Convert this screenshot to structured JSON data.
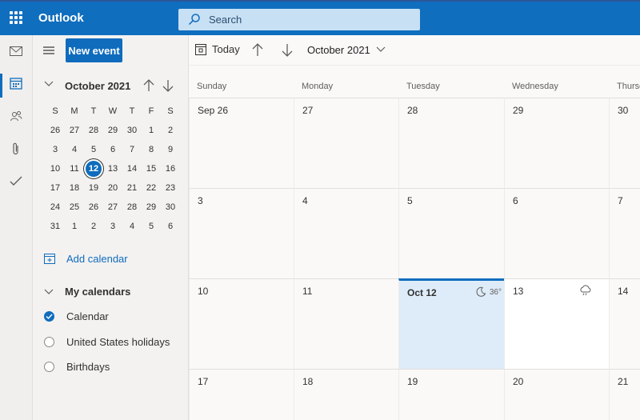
{
  "app": {
    "title": "Outlook"
  },
  "search": {
    "placeholder": "Search"
  },
  "colors": {
    "brand": "#106ebe",
    "accent": "#0f6cbd",
    "today_bg": "#deecf9"
  },
  "rail": {
    "items": [
      "mail-icon",
      "calendar-icon",
      "people-icon",
      "attachment-icon",
      "todo-icon"
    ]
  },
  "pane": {
    "new_event": "New event",
    "mini": {
      "month": "October 2021",
      "weekdays": [
        "S",
        "M",
        "T",
        "W",
        "T",
        "F",
        "S"
      ],
      "weeks": [
        [
          "26",
          "27",
          "28",
          "29",
          "30",
          "1",
          "2"
        ],
        [
          "3",
          "4",
          "5",
          "6",
          "7",
          "8",
          "9"
        ],
        [
          "10",
          "11",
          "12",
          "13",
          "14",
          "15",
          "16"
        ],
        [
          "17",
          "18",
          "19",
          "20",
          "21",
          "22",
          "23"
        ],
        [
          "24",
          "25",
          "26",
          "27",
          "28",
          "29",
          "30"
        ],
        [
          "31",
          "1",
          "2",
          "3",
          "4",
          "5",
          "6"
        ]
      ],
      "today": "12"
    },
    "add_calendar": "Add calendar",
    "my_calendars": "My calendars",
    "calendars": [
      {
        "label": "Calendar",
        "checked": true
      },
      {
        "label": "United States holidays",
        "checked": false
      },
      {
        "label": "Birthdays",
        "checked": false
      }
    ]
  },
  "toolbar": {
    "today": "Today",
    "month": "October 2021"
  },
  "month_view": {
    "days": [
      "Sunday",
      "Monday",
      "Tuesday",
      "Wednesday",
      "Thursday"
    ],
    "weeks": [
      [
        "Sep 26",
        "27",
        "28",
        "29",
        "30"
      ],
      [
        "3",
        "4",
        "5",
        "6",
        "7"
      ],
      [
        "10",
        "11",
        "Oct 12",
        "13",
        "14"
      ],
      [
        "17",
        "18",
        "19",
        "20",
        "21"
      ]
    ],
    "weather_today": "36°"
  }
}
